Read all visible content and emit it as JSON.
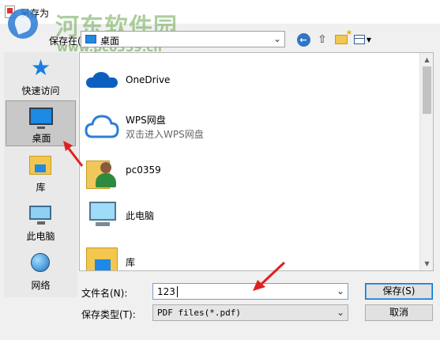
{
  "window": {
    "title": "另存为"
  },
  "watermark": {
    "name": "河东软件园",
    "url": "www.pc0359.cn"
  },
  "toolbar": {
    "save_in_label": "保存在(I):",
    "save_in_value": "桌面",
    "back_icon": "back-arrow-icon",
    "up_icon": "up-folder-icon",
    "new_folder_icon": "new-folder-icon",
    "view_icon": "view-menu-icon"
  },
  "places": [
    {
      "label": "快速访问",
      "icon": "star-icon"
    },
    {
      "label": "桌面",
      "icon": "desktop-icon"
    },
    {
      "label": "库",
      "icon": "library-icon"
    },
    {
      "label": "此电脑",
      "icon": "computer-icon"
    },
    {
      "label": "网络",
      "icon": "network-icon"
    }
  ],
  "files": [
    {
      "name": "OneDrive",
      "icon": "onedrive-icon"
    },
    {
      "name": "WPS网盘",
      "sub": "双击进入WPS网盘",
      "icon": "wps-cloud-icon"
    },
    {
      "name": "pc0359",
      "icon": "user-folder-icon"
    },
    {
      "name": "此电脑",
      "icon": "computer-icon"
    },
    {
      "name": "库",
      "icon": "library-icon"
    }
  ],
  "form": {
    "filename_label": "文件名(N):",
    "filename_value": "123",
    "filetype_label": "保存类型(T):",
    "filetype_value": "PDF files(*.pdf)",
    "save_button": "保存(S)",
    "cancel_button": "取消"
  },
  "colors": {
    "accent": "#0078d7",
    "annotation": "#e02020"
  }
}
